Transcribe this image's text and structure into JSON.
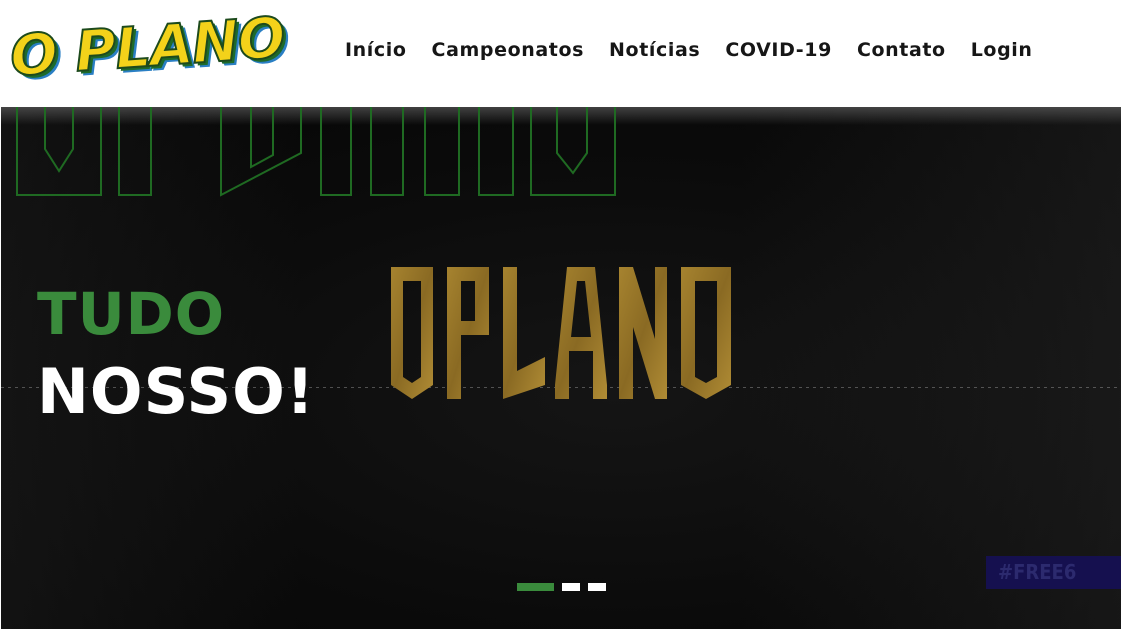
{
  "brand": {
    "logo_text": "O PLANO",
    "center_logo_text": "OPLANO"
  },
  "nav": {
    "items": [
      {
        "label": "Início"
      },
      {
        "label": "Campeonatos"
      },
      {
        "label": "Notícias"
      },
      {
        "label": "COVID-19"
      },
      {
        "label": "Contato"
      },
      {
        "label": "Login"
      }
    ]
  },
  "hero": {
    "tagline_line1": "TUDO",
    "tagline_line2": "NOSSO!",
    "badge_text": "#FREE6",
    "slides": [
      {
        "active": true
      },
      {
        "active": false
      },
      {
        "active": false
      }
    ]
  },
  "colors": {
    "accent_green": "#3a8b3c",
    "logo_yellow": "#f3d21a",
    "center_logo_gold": "#9a7a2c",
    "badge_bg": "#15104f",
    "hero_bg": "#0b0b0b"
  },
  "icons": {
    "logo": "o-plano-logo",
    "center_logo": "oplano-gold-logo"
  }
}
